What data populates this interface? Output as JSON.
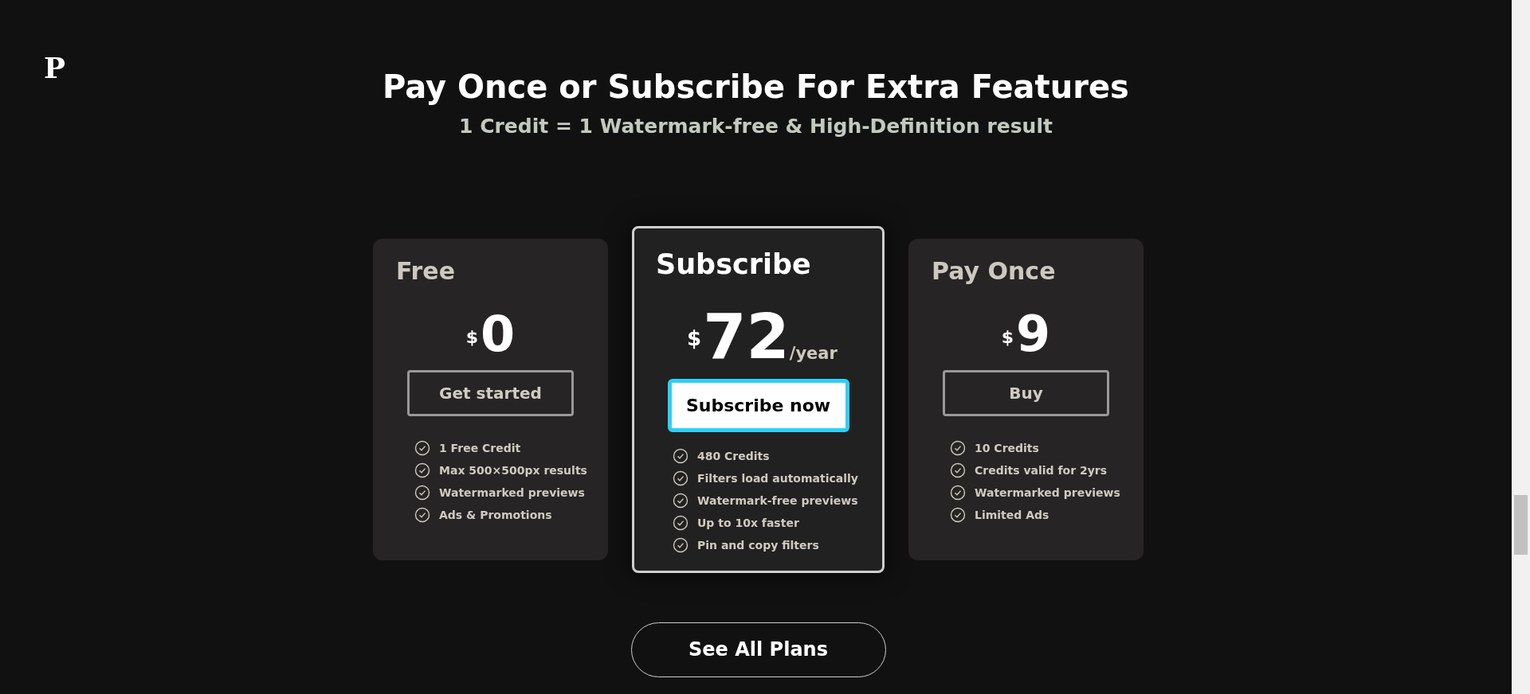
{
  "logo": "P",
  "heading": {
    "title": "Pay Once or Subscribe For Extra Features",
    "subtitle": "1 Credit = 1 Watermark-free & High-Definition result"
  },
  "plans": [
    {
      "name": "Free",
      "highlighted": false,
      "currency": "$",
      "price": "0",
      "button": "Get started",
      "features": [
        "1 Free Credit",
        "Max 500×500px results",
        "Watermarked previews",
        "Ads & Promotions"
      ]
    },
    {
      "name": "Subscribe",
      "highlighted": true,
      "currency": "$",
      "price": "72",
      "period": "/year",
      "button": "Subscribe now",
      "features": [
        "480 Credits",
        "Filters load automatically",
        "Watermark-free previews",
        "Up to 10x faster",
        "Pin and copy filters"
      ]
    },
    {
      "name": "Pay Once",
      "highlighted": false,
      "currency": "$",
      "price": "9",
      "button": "Buy",
      "features": [
        "10 Credits",
        "Credits valid for 2yrs",
        "Watermarked previews",
        "Limited Ads"
      ]
    }
  ],
  "see_all_button": "See All Plans"
}
